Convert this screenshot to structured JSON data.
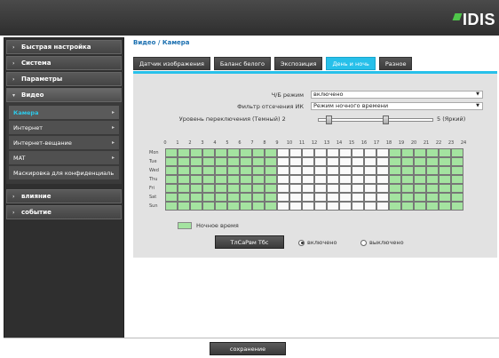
{
  "logo": {
    "text": "IDIS"
  },
  "sidebar": {
    "items": [
      {
        "label": "Быстрая настройка"
      },
      {
        "label": "Система"
      },
      {
        "label": "Параметры"
      },
      {
        "label": "Видео"
      }
    ],
    "subitems": [
      {
        "label": "Камера"
      },
      {
        "label": "Интернет"
      },
      {
        "label": "Интернет-вещание"
      },
      {
        "label": "MAT"
      },
      {
        "label": "Маскировка для конфиденциаль"
      }
    ],
    "bottom_items": [
      {
        "label": "влияние"
      },
      {
        "label": "событие"
      }
    ]
  },
  "breadcrumb": "Видео / Камера",
  "tabs": [
    {
      "label": "Датчик изображения"
    },
    {
      "label": "Баланс белого"
    },
    {
      "label": "Экспозиция"
    },
    {
      "label": "День и ночь"
    },
    {
      "label": "Разное"
    }
  ],
  "form": {
    "bw_mode_label": "Ч/Б режим",
    "bw_mode_value": "включено",
    "ir_filter_label": "Фильтр отсечения ИК",
    "ir_filter_value": "Режим ночного времени",
    "switch_level_label": "Уровень переключения",
    "switch_level_min": "(Темный)  2",
    "switch_level_max": "5  (Яркий)"
  },
  "schedule": {
    "hours": [
      "0",
      "1",
      "2",
      "3",
      "4",
      "5",
      "6",
      "7",
      "8",
      "9",
      "10",
      "11",
      "12",
      "13",
      "14",
      "15",
      "16",
      "17",
      "18",
      "19",
      "20",
      "21",
      "22",
      "23",
      "24"
    ],
    "days": [
      "Mon",
      "Tue",
      "Wed",
      "Thu",
      "Fri",
      "Sat",
      "Sun"
    ],
    "legend": "Ночное время",
    "night_hours": [
      0,
      1,
      2,
      3,
      4,
      5,
      6,
      7,
      8,
      18,
      19,
      20,
      21,
      22,
      23
    ]
  },
  "actions": {
    "apply_label": "ТлСаРвм Тбс",
    "radio_on": "включено",
    "radio_off": "выключено",
    "save_label": "сохранение"
  },
  "colors": {
    "accent": "#27c0ea",
    "night": "#a4e3a0"
  }
}
